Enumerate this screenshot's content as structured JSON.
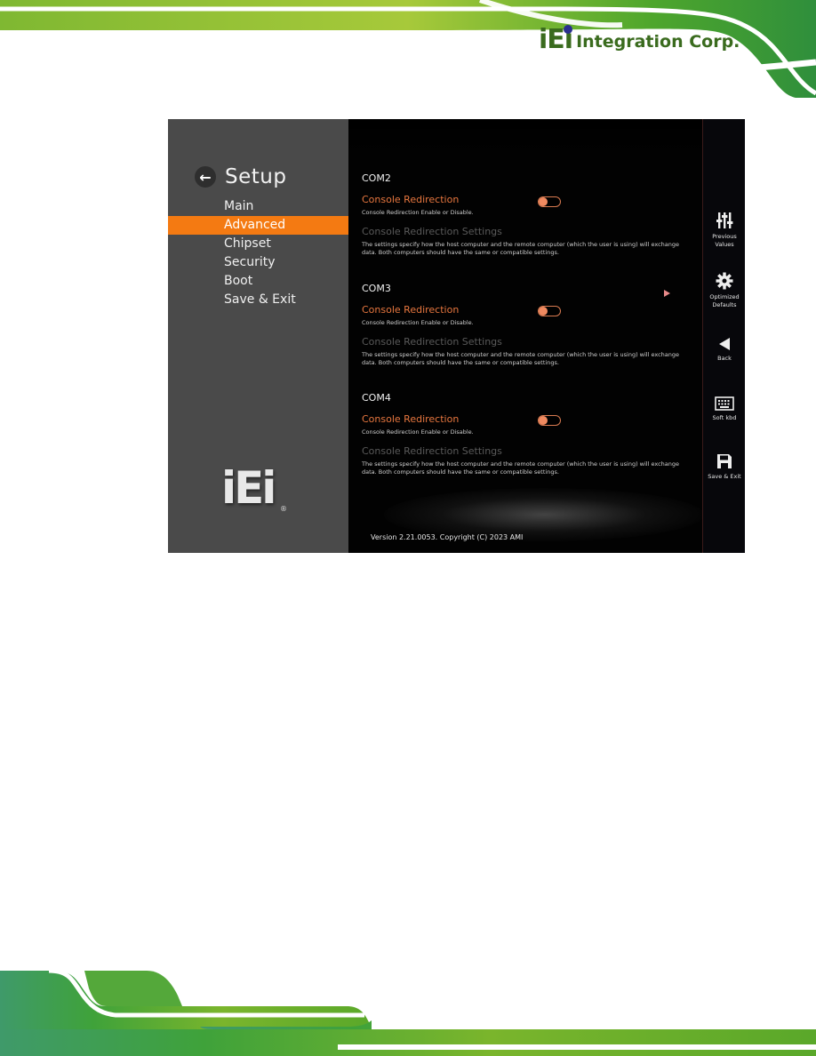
{
  "page": {
    "brand": {
      "mark": "iEi",
      "name": "Integration Corp."
    },
    "colors": {
      "accent": "#f47a12",
      "item_label": "#e8773f",
      "sidebar_bg": "#4a4a4a",
      "screen_bg": "#000000",
      "banner_green": "#4caf2a"
    }
  },
  "bios": {
    "header": {
      "back_icon": "arrow-left-icon",
      "title": "Setup"
    },
    "menu": [
      {
        "label": "Main",
        "active": false
      },
      {
        "label": "Advanced",
        "active": true
      },
      {
        "label": "Chipset",
        "active": false
      },
      {
        "label": "Security",
        "active": false
      },
      {
        "label": "Boot",
        "active": false
      },
      {
        "label": "Save & Exit",
        "active": false
      }
    ],
    "side_logo": {
      "mark": "iEi",
      "reg": "®"
    },
    "sections": [
      {
        "title": "COM2",
        "item_label": "Console Redirection",
        "item_help": "Console Redirection Enable or Disable.",
        "toggle_state": "off",
        "sub_label": "Console Redirection Settings",
        "sub_help": "The settings specify how the host computer and the remote computer (which the user is using) will exchange data. Both computers should have the same or compatible settings."
      },
      {
        "title": "COM3",
        "item_label": "Console Redirection",
        "item_help": "Console Redirection Enable or Disable.",
        "toggle_state": "off",
        "sub_label": "Console Redirection Settings",
        "sub_help": "The settings specify how the host computer and the remote computer (which the user is using) will exchange data. Both computers should have the same or compatible settings."
      },
      {
        "title": "COM4",
        "item_label": "Console Redirection",
        "item_help": "Console Redirection Enable or Disable.",
        "toggle_state": "off",
        "sub_label": "Console Redirection Settings",
        "sub_help": "The settings specify how the host computer and the remote computer (which the user is using) will exchange data. Both computers should have the same or compatible settings."
      }
    ],
    "version": "Version 2.21.0053. Copyright (C) 2023 AMI",
    "rightbar": [
      {
        "icon": "sliders-icon",
        "label_line1": "Previous",
        "label_line2": "Values"
      },
      {
        "icon": "gear-icon",
        "label_line1": "Optimized",
        "label_line2": "Defaults"
      },
      {
        "icon": "back-triangle-icon",
        "label_line1": "Back",
        "label_line2": ""
      },
      {
        "icon": "keyboard-icon",
        "label_line1": "Soft kbd",
        "label_line2": ""
      },
      {
        "icon": "floppy-save-icon",
        "label_line1": "Save & Exit",
        "label_line2": ""
      }
    ]
  }
}
